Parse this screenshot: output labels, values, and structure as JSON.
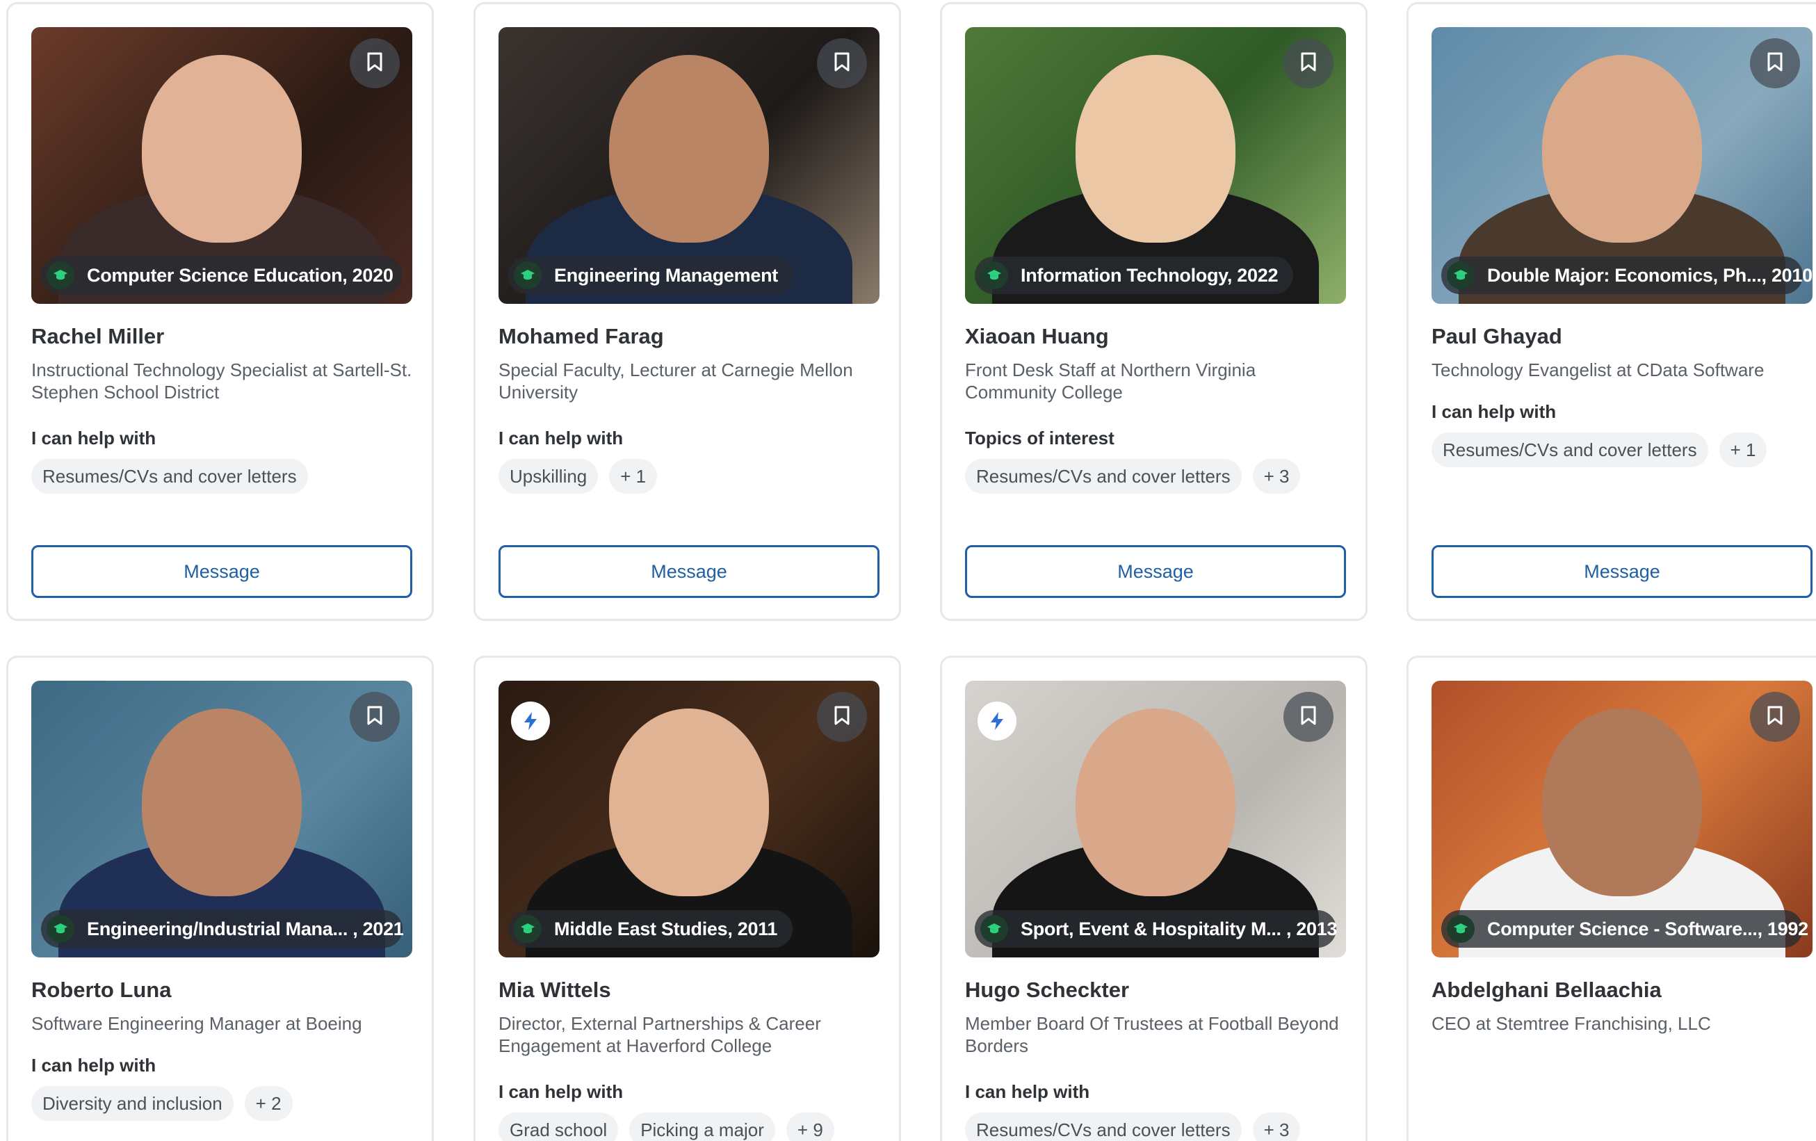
{
  "labels": {
    "help": "I can help with",
    "topics": "Topics of interest",
    "at": "at",
    "message": "Message"
  },
  "icons": {
    "bookmark": "bookmark-icon",
    "education": "graduation-cap-icon",
    "bolt": "lightning-bolt-icon"
  },
  "colors": {
    "accent": "#1f5fa6",
    "edu_icon": "#2bd17e",
    "bolt": "#2b6fd6"
  },
  "mentors": [
    {
      "name": "Rachel Miller",
      "role": "Instructional Technology Specialist",
      "org": "Sartell-St. Stephen School District",
      "education": "Computer Science Education, 2020",
      "section": "help",
      "chips": [
        "Resumes/CVs and cover letters"
      ],
      "quick_responder": false
    },
    {
      "name": "Mohamed Farag",
      "role": "Special Faculty, Lecturer",
      "org": "Carnegie Mellon University",
      "education": "Engineering Management",
      "section": "help",
      "chips": [
        "Upskilling",
        "+ 1"
      ],
      "quick_responder": false
    },
    {
      "name": "Xiaoan Huang",
      "role": "Front Desk Staff",
      "org": "Northern Virginia Community College",
      "education": "Information Technology, 2022",
      "section": "topics",
      "chips": [
        "Resumes/CVs and cover letters",
        "+ 3"
      ],
      "quick_responder": false
    },
    {
      "name": "Paul Ghayad",
      "role": "Technology Evangelist",
      "org": "CData Software",
      "education": "Double Major: Economics, Ph..., 2010",
      "section": "help",
      "chips": [
        "Resumes/CVs and cover letters",
        "+ 1"
      ],
      "quick_responder": false
    },
    {
      "name": "Roberto Luna",
      "role": "Software Engineering Manager",
      "org": "Boeing",
      "education": "Engineering/Industrial Mana... , 2021",
      "section": "help",
      "chips": [
        "Diversity and inclusion",
        "+ 2"
      ],
      "quick_responder": false
    },
    {
      "name": "Mia Wittels",
      "role": "Director, External Partnerships & Career Engagement",
      "org": "Haverford College",
      "education": "Middle East Studies, 2011",
      "section": "help",
      "chips": [
        "Grad school",
        "Picking a major",
        "+ 9"
      ],
      "quick_responder": true
    },
    {
      "name": "Hugo Scheckter",
      "role": "Member Board Of Trustees",
      "org": "Football Beyond Borders",
      "education": "Sport, Event & Hospitality M... , 2013",
      "section": "help",
      "chips": [
        "Resumes/CVs and cover letters",
        "+ 3"
      ],
      "quick_responder": true
    },
    {
      "name": "Abdelghani Bellaachia",
      "role": "CEO",
      "org": "Stemtree Franchising, LLC",
      "education": "Computer Science - Software..., 1992",
      "section": "none",
      "chips": [],
      "quick_responder": false
    }
  ]
}
